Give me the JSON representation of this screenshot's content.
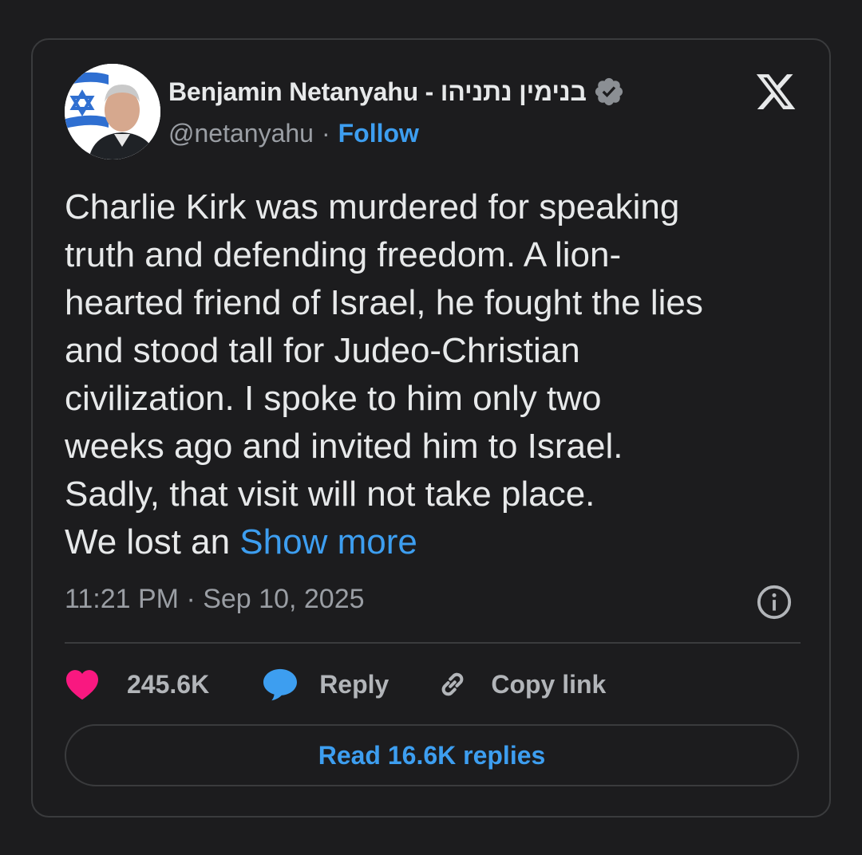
{
  "author": {
    "display_name": "Benjamin Netanyahu - בנימין נתניהו",
    "handle": "@netanyahu",
    "separator": "·",
    "follow_label": "Follow",
    "verified_badge_icon": "verified-badge-icon",
    "avatar": "avatar"
  },
  "platform_logo": "x-logo-icon",
  "tweet": {
    "lines": [
      "Charlie Kirk was murdered for speaking",
      "truth and defending freedom. A lion-",
      "hearted friend of Israel, he fought the lies",
      "and stood tall for Judeo-Christian",
      "civilization. I spoke to him only two",
      "weeks ago and invited him to Israel.",
      "Sadly, that visit will not take place."
    ],
    "last_line_prefix": "We lost an ",
    "show_more_label": "Show more"
  },
  "meta": {
    "timestamp": "11:21 PM · Sep 10, 2025",
    "info_icon": "info-icon"
  },
  "actions": {
    "like_count": "245.6K",
    "reply_label": "Reply",
    "copy_link_label": "Copy link"
  },
  "read_replies_label": "Read 16.6K replies",
  "colors": {
    "background": "#1c1c1e",
    "card_border": "#3a3b3d",
    "text_primary": "#e7e9ea",
    "text_secondary": "#9a9ea4",
    "link_blue": "#3d9ef0",
    "like_pink": "#f91880",
    "verified_gray": "#8b8f94"
  }
}
